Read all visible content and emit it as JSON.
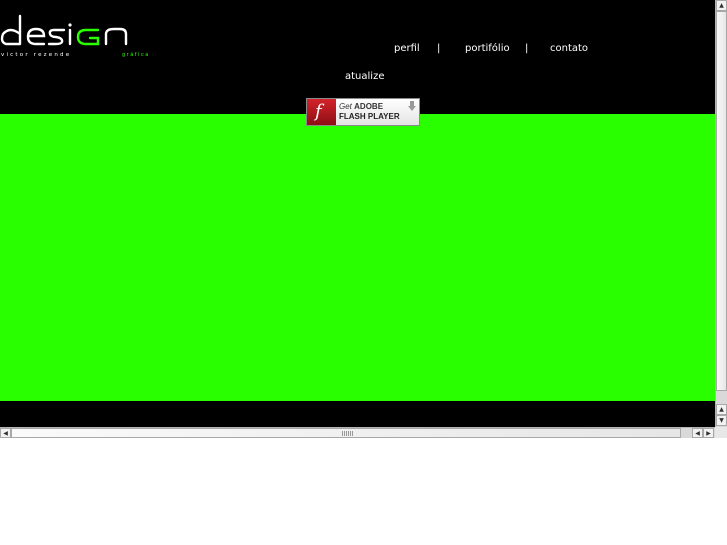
{
  "logo": {
    "main": "design",
    "tagline": "victor rezende",
    "subtitle": "gráfica"
  },
  "nav": {
    "items": [
      {
        "label": "perfil"
      },
      {
        "label": "portifólio"
      },
      {
        "label": "contato"
      }
    ],
    "separator": "|",
    "update_label": "atualize"
  },
  "flash_badge": {
    "line1_prefix": "Get",
    "line1_brand": "ADOBE",
    "line2": "FLASH PLAYER",
    "logo_glyph": "f",
    "arrow_icon": "download-arrow-icon"
  },
  "colors": {
    "background": "#000000",
    "stage": "#2aff00",
    "text": "#ffffff",
    "accent": "#2aff00"
  },
  "scrollbars": {
    "up_icon": "▲",
    "down_icon": "▼",
    "left_icon": "◀",
    "right_icon": "▶"
  }
}
